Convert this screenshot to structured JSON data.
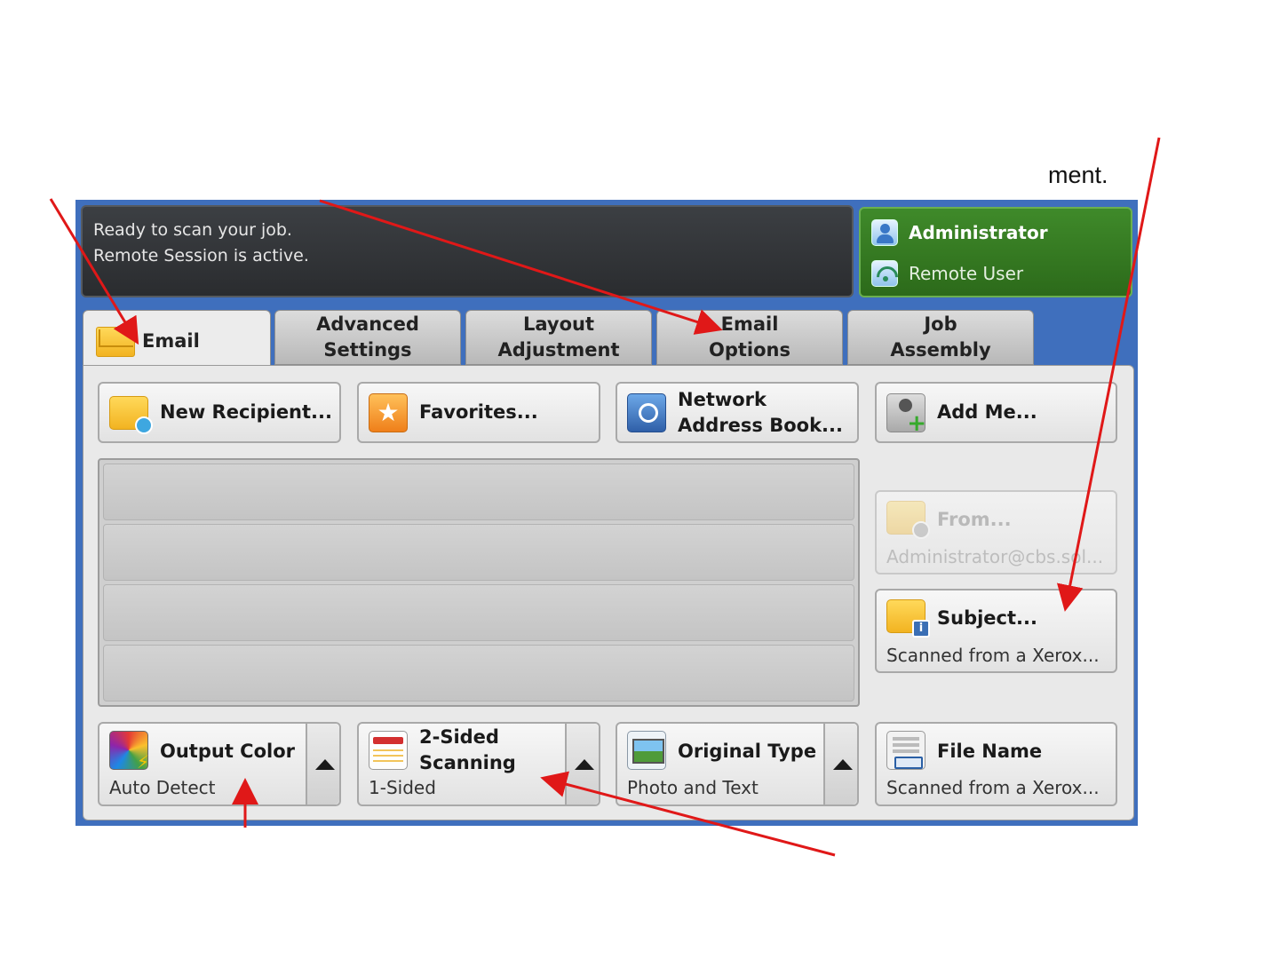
{
  "slide": {
    "caption": "ment."
  },
  "status": {
    "line1": "Ready to scan your job.",
    "line2": "Remote Session is active."
  },
  "user_panel": {
    "admin_label": "Administrator",
    "remote_label": "Remote User"
  },
  "tabs": [
    {
      "label": "Email",
      "active": true
    },
    {
      "label": "Advanced\nSettings"
    },
    {
      "label": "Layout\nAdjustment"
    },
    {
      "label": "Email\nOptions"
    },
    {
      "label": "Job\nAssembly"
    }
  ],
  "buttons": {
    "new_recipient": "New Recipient...",
    "favorites": "Favorites...",
    "address_book": "Network\nAddress Book...",
    "add_me": "Add Me...",
    "from": {
      "title": "From...",
      "value": "Administrator@cbs.sol..."
    },
    "subject": {
      "title": "Subject...",
      "value": "Scanned from a Xerox..."
    },
    "output_color": {
      "title": "Output Color",
      "value": "Auto Detect"
    },
    "two_sided": {
      "title": "2-Sided\nScanning",
      "value": "1-Sided"
    },
    "original_type": {
      "title": "Original Type",
      "value": "Photo and Text"
    },
    "file_name": {
      "title": "File Name",
      "value": "Scanned from a Xerox..."
    }
  },
  "colors": {
    "panel_blue": "#3f6fbd",
    "admin_green": "#3f8a2a",
    "status_dark": "#2e3033",
    "annotation_red": "#e01818"
  }
}
